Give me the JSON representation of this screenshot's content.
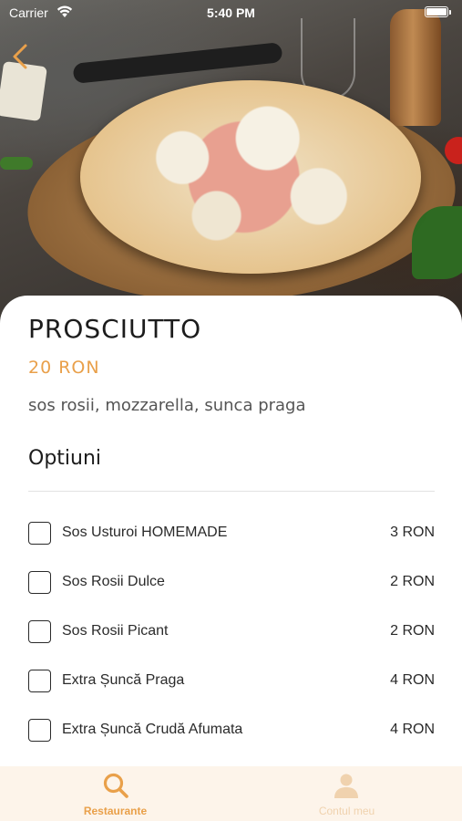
{
  "status_bar": {
    "carrier": "Carrier",
    "time": "5:40 PM",
    "wifi_icon": "wifi-icon",
    "battery_icon": "battery-icon"
  },
  "header": {
    "back_icon": "chevron-left-icon"
  },
  "product": {
    "name": "PROSCIUTTO",
    "price": "20 RON",
    "description": "sos rosii, mozzarella, sunca praga"
  },
  "options": {
    "heading": "Optiuni",
    "items": [
      {
        "label": "Sos Usturoi HOMEMADE",
        "price": "3 RON",
        "checked": false
      },
      {
        "label": "Sos Rosii Dulce",
        "price": "2 RON",
        "checked": false
      },
      {
        "label": "Sos Rosii Picant",
        "price": "2 RON",
        "checked": false
      },
      {
        "label": "Extra Șuncă Praga",
        "price": "4 RON",
        "checked": false
      },
      {
        "label": "Extra Șuncă Crudă Afumata",
        "price": "4 RON",
        "checked": false
      }
    ]
  },
  "tab_bar": {
    "tabs": [
      {
        "label": "Restaurante",
        "icon": "search-icon",
        "active": true
      },
      {
        "label": "Contul meu",
        "icon": "person-icon",
        "active": false
      }
    ]
  },
  "colors": {
    "accent": "#e9a04a",
    "tab_bar_background": "#fdf4ea",
    "inactive_tab": "#f0d2ae"
  }
}
